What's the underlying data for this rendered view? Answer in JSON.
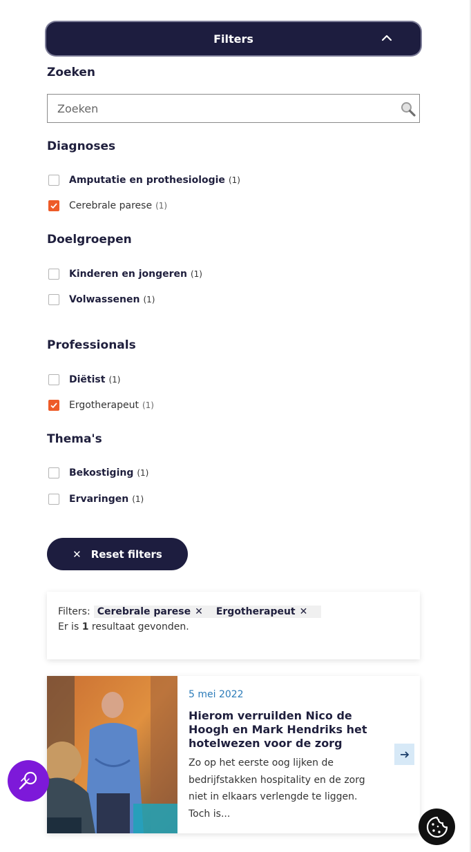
{
  "filters_toggle": {
    "label": "Filters"
  },
  "search": {
    "title": "Zoeken",
    "placeholder": "Zoeken"
  },
  "groups": {
    "diagnoses": {
      "title": "Diagnoses",
      "items": [
        {
          "label": "Amputatie en prothesiologie",
          "count": "(1)",
          "checked": false
        },
        {
          "label": "Cerebrale parese",
          "count": "(1)",
          "checked": true
        }
      ]
    },
    "doelgroepen": {
      "title": "Doelgroepen",
      "items": [
        {
          "label": "Kinderen en jongeren",
          "count": "(1)",
          "checked": false
        },
        {
          "label": "Volwassenen",
          "count": "(1)",
          "checked": false
        }
      ]
    },
    "professionals": {
      "title": "Professionals",
      "items": [
        {
          "label": "Diëtist",
          "count": "(1)",
          "checked": false
        },
        {
          "label": "Ergotherapeut",
          "count": "(1)",
          "checked": true
        }
      ]
    },
    "themas": {
      "title": "Thema's",
      "items": [
        {
          "label": "Bekostiging",
          "count": "(1)",
          "checked": false
        },
        {
          "label": "Ervaringen",
          "count": "(1)",
          "checked": false
        }
      ]
    }
  },
  "reset": {
    "label": "Reset filters"
  },
  "summary": {
    "filters_label": "Filters:",
    "chips": [
      "Cerebrale parese",
      "Ergotherapeut"
    ],
    "result_prefix": "Er is",
    "result_count": "1",
    "result_suffix": "resultaat gevonden."
  },
  "card": {
    "date": "5 mei 2022",
    "title": "Hierom verruilden Nico de Hoogh en Mark Hendriks het hotelwezen voor de zorg",
    "excerpt": "Zo op het eerste oog lijken de bedrijfstakken hospitality en de zorg niet in elkaars verlengde te liggen. Toch is..."
  },
  "colors": {
    "navy": "#1d1d3f",
    "orange": "#ee5b28",
    "purple": "#7d19d9",
    "date_blue": "#2b7bb9"
  }
}
